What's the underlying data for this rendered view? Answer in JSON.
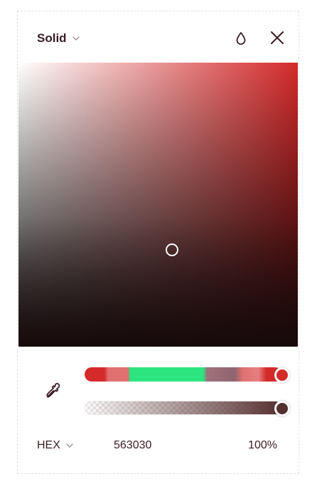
{
  "header": {
    "mode_label": "Solid",
    "mode_icon": "chevron-down-icon",
    "drop_icon": "drop-icon",
    "close_icon": "close-icon"
  },
  "picker": {
    "hue_color": "#d42a2a",
    "saturation": 0.55,
    "brightness": 0.34,
    "alpha": 1.0
  },
  "tools": {
    "eyedropper_icon": "eyedropper-icon"
  },
  "values": {
    "format_label": "HEX",
    "format_icon": "chevron-down-icon",
    "hex": "563030",
    "alpha_percent": "100%"
  },
  "colors": {
    "text": "#3a1d24",
    "accent_green": "#2de57f",
    "selected": "#563030"
  }
}
